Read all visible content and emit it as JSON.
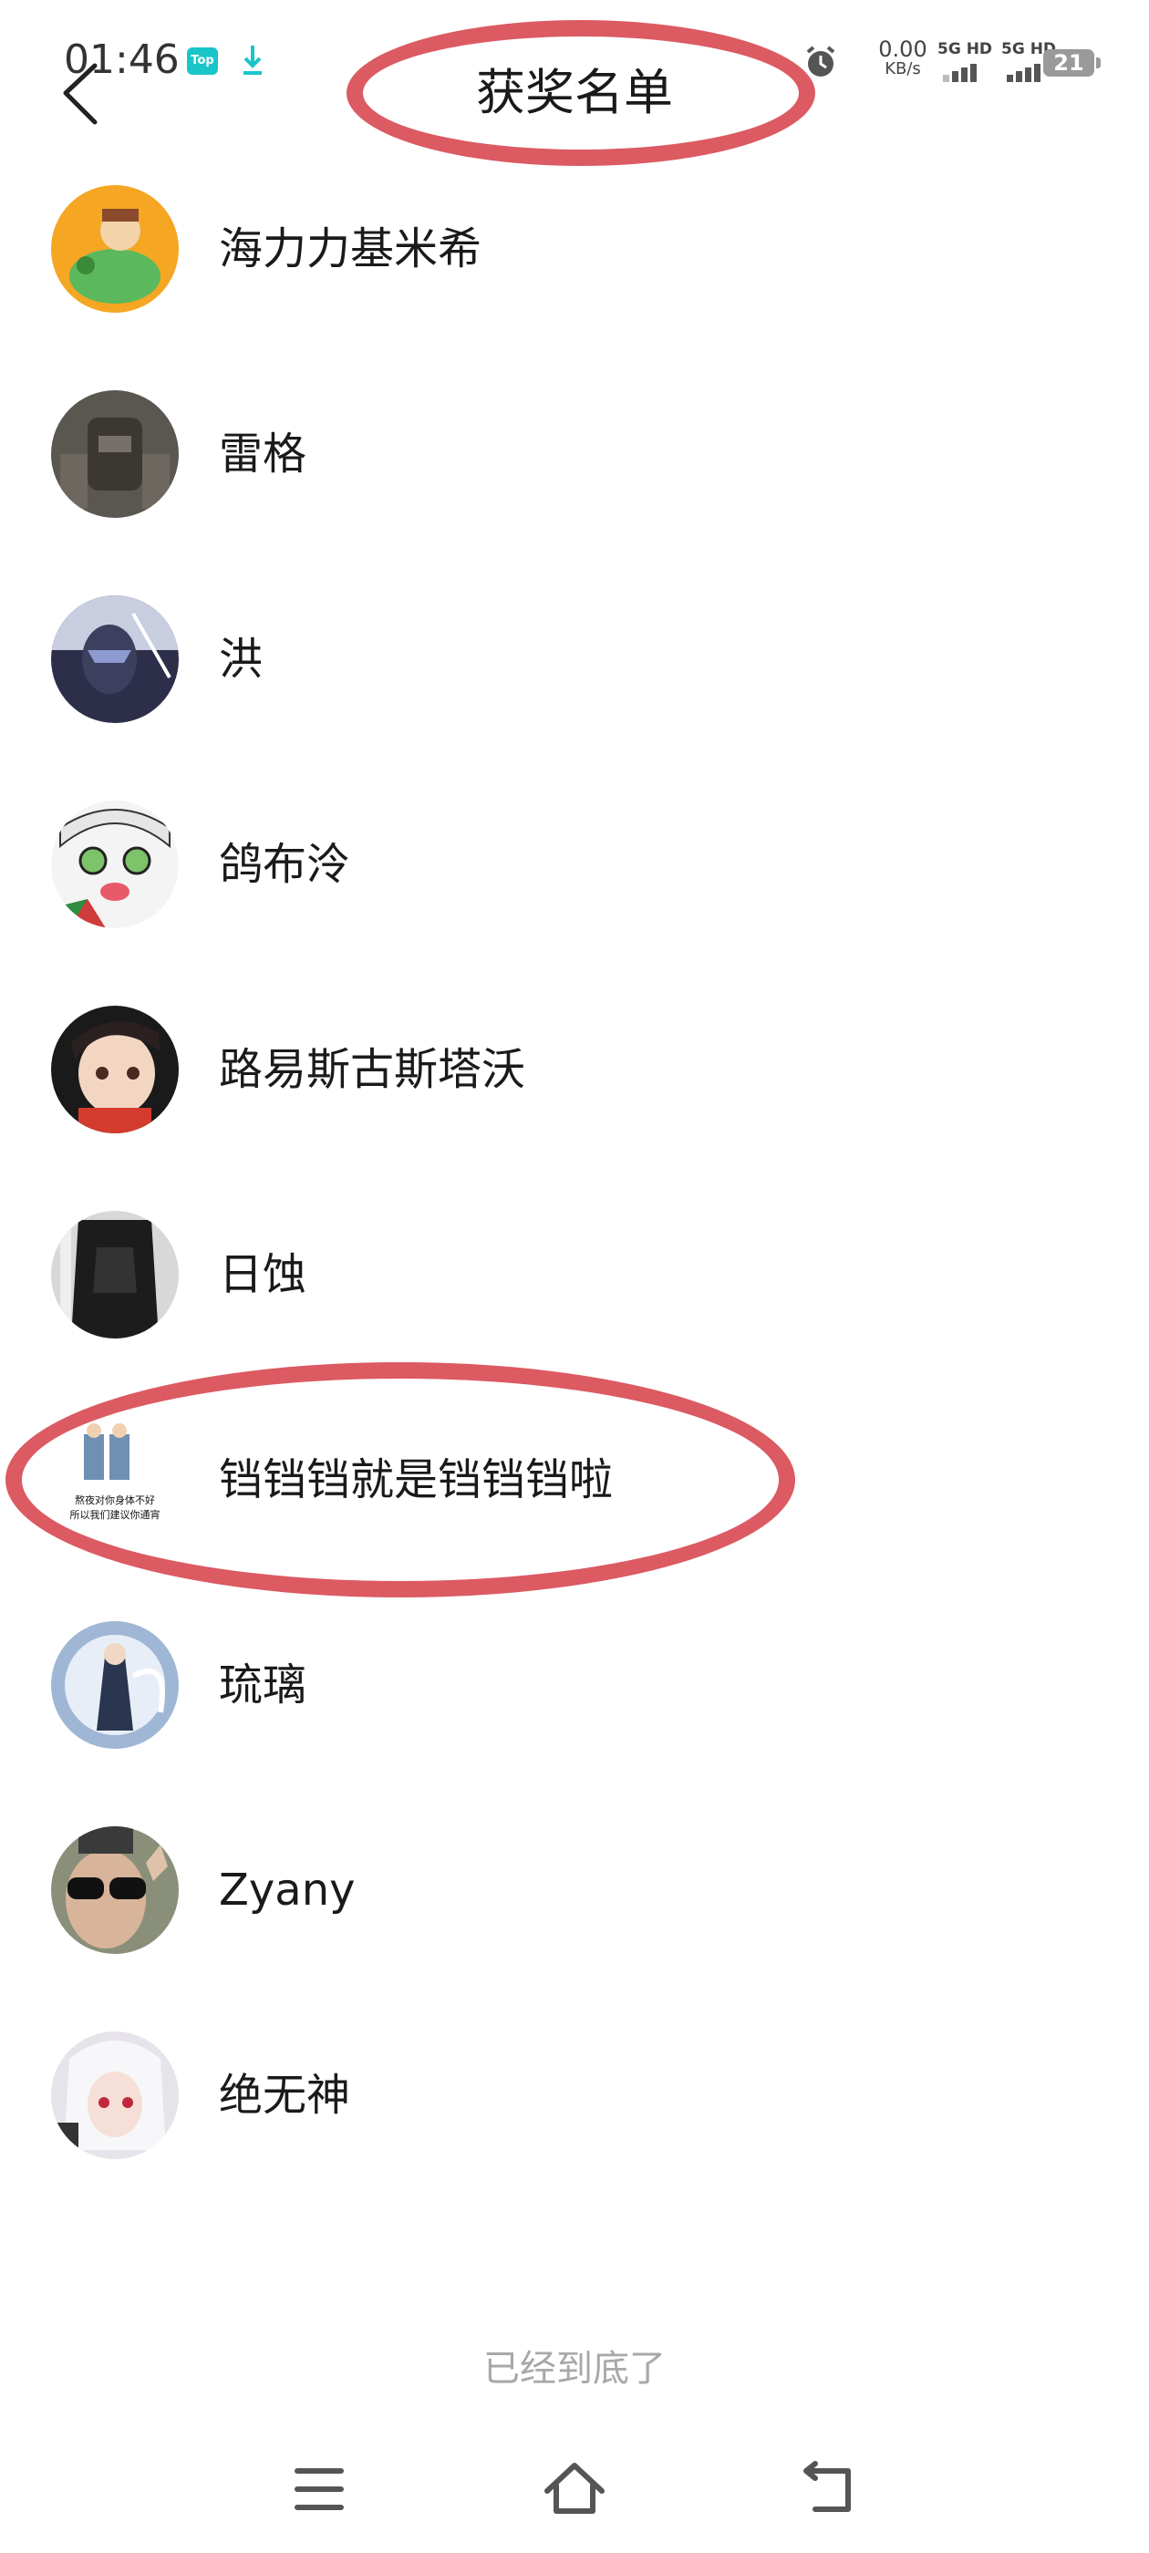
{
  "status_bar": {
    "time": "01:46",
    "app_badge": "Top",
    "net_speed_value": "0.00",
    "net_speed_unit": "KB/s",
    "sim1_label": "5G HD",
    "sim2_label": "5G HD",
    "battery": "21"
  },
  "header": {
    "title": "获奖名单"
  },
  "winners": [
    {
      "name": "海力力基米希"
    },
    {
      "name": "雷格"
    },
    {
      "name": "洪"
    },
    {
      "name": "鸽布泠"
    },
    {
      "name": "路易斯古斯塔沃"
    },
    {
      "name": "日蚀"
    },
    {
      "name": "铛铛铛就是铛铛铛啦",
      "avatar_caption": "熬夜对你身体不好 所以我们建议你通宵"
    },
    {
      "name": "琉璃"
    },
    {
      "name": "Zyany"
    },
    {
      "name": "绝无神"
    }
  ],
  "footer": {
    "end_note": "已经到底了"
  },
  "colors": {
    "highlight": "#dc5a62",
    "background": "#ffffff",
    "text": "#1a1a1a",
    "muted": "#a8a8a8"
  }
}
